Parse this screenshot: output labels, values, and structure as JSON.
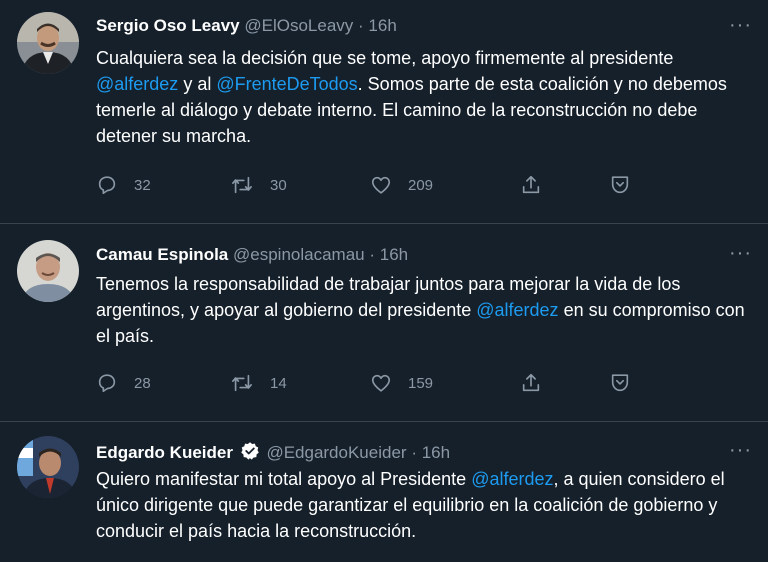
{
  "tweets": [
    {
      "name": "Sergio Oso Leavy",
      "handle": "@ElOsoLeavy",
      "dot": "·",
      "time": "16h",
      "more": "···",
      "text": {
        "p1": "Cualquiera sea la decisión que se tome, apoyo firmemente al presidente",
        "m1": "@alferdez",
        "p2": " y al ",
        "m2": "@FrenteDeTodos",
        "p3": ". Somos parte de esta coalición y no debemos temerle al diálogo y debate interno. El camino de la reconstrucción no debe detener su marcha."
      },
      "replies": "32",
      "retweets": "30",
      "likes": "209"
    },
    {
      "name": "Camau Espinola",
      "handle": "@espinolacamau",
      "dot": "·",
      "time": "16h",
      "more": "···",
      "text": {
        "p1": "Tenemos la responsabilidad de trabajar juntos para mejorar la vida de los argentinos, y apoyar al gobierno del presidente ",
        "m1": "@alferdez",
        "p2": " en su compromiso con el país."
      },
      "replies": "28",
      "retweets": "14",
      "likes": "159"
    },
    {
      "name": "Edgardo Kueider",
      "handle": "@EdgardoKueider",
      "dot": "·",
      "time": "16h",
      "more": "···",
      "verified": true,
      "text": {
        "p1": "Quiero manifestar mi total apoyo al Presidente ",
        "m1": "@alferdez",
        "p2": ", a quien considero el único dirigente que puede garantizar el equilibrio en la coalición de gobierno y conducir el país hacia la reconstrucción."
      }
    }
  ],
  "colors": {
    "background": "#15202b",
    "text": "#ffffff",
    "muted": "#8b98a5",
    "link": "#1d9bf0",
    "divider": "#38444d",
    "verified": "#ffffff"
  },
  "icons": [
    "reply-icon",
    "retweet-icon",
    "like-icon",
    "share-icon",
    "bookmark-icon",
    "more-icon",
    "verified-icon"
  ]
}
